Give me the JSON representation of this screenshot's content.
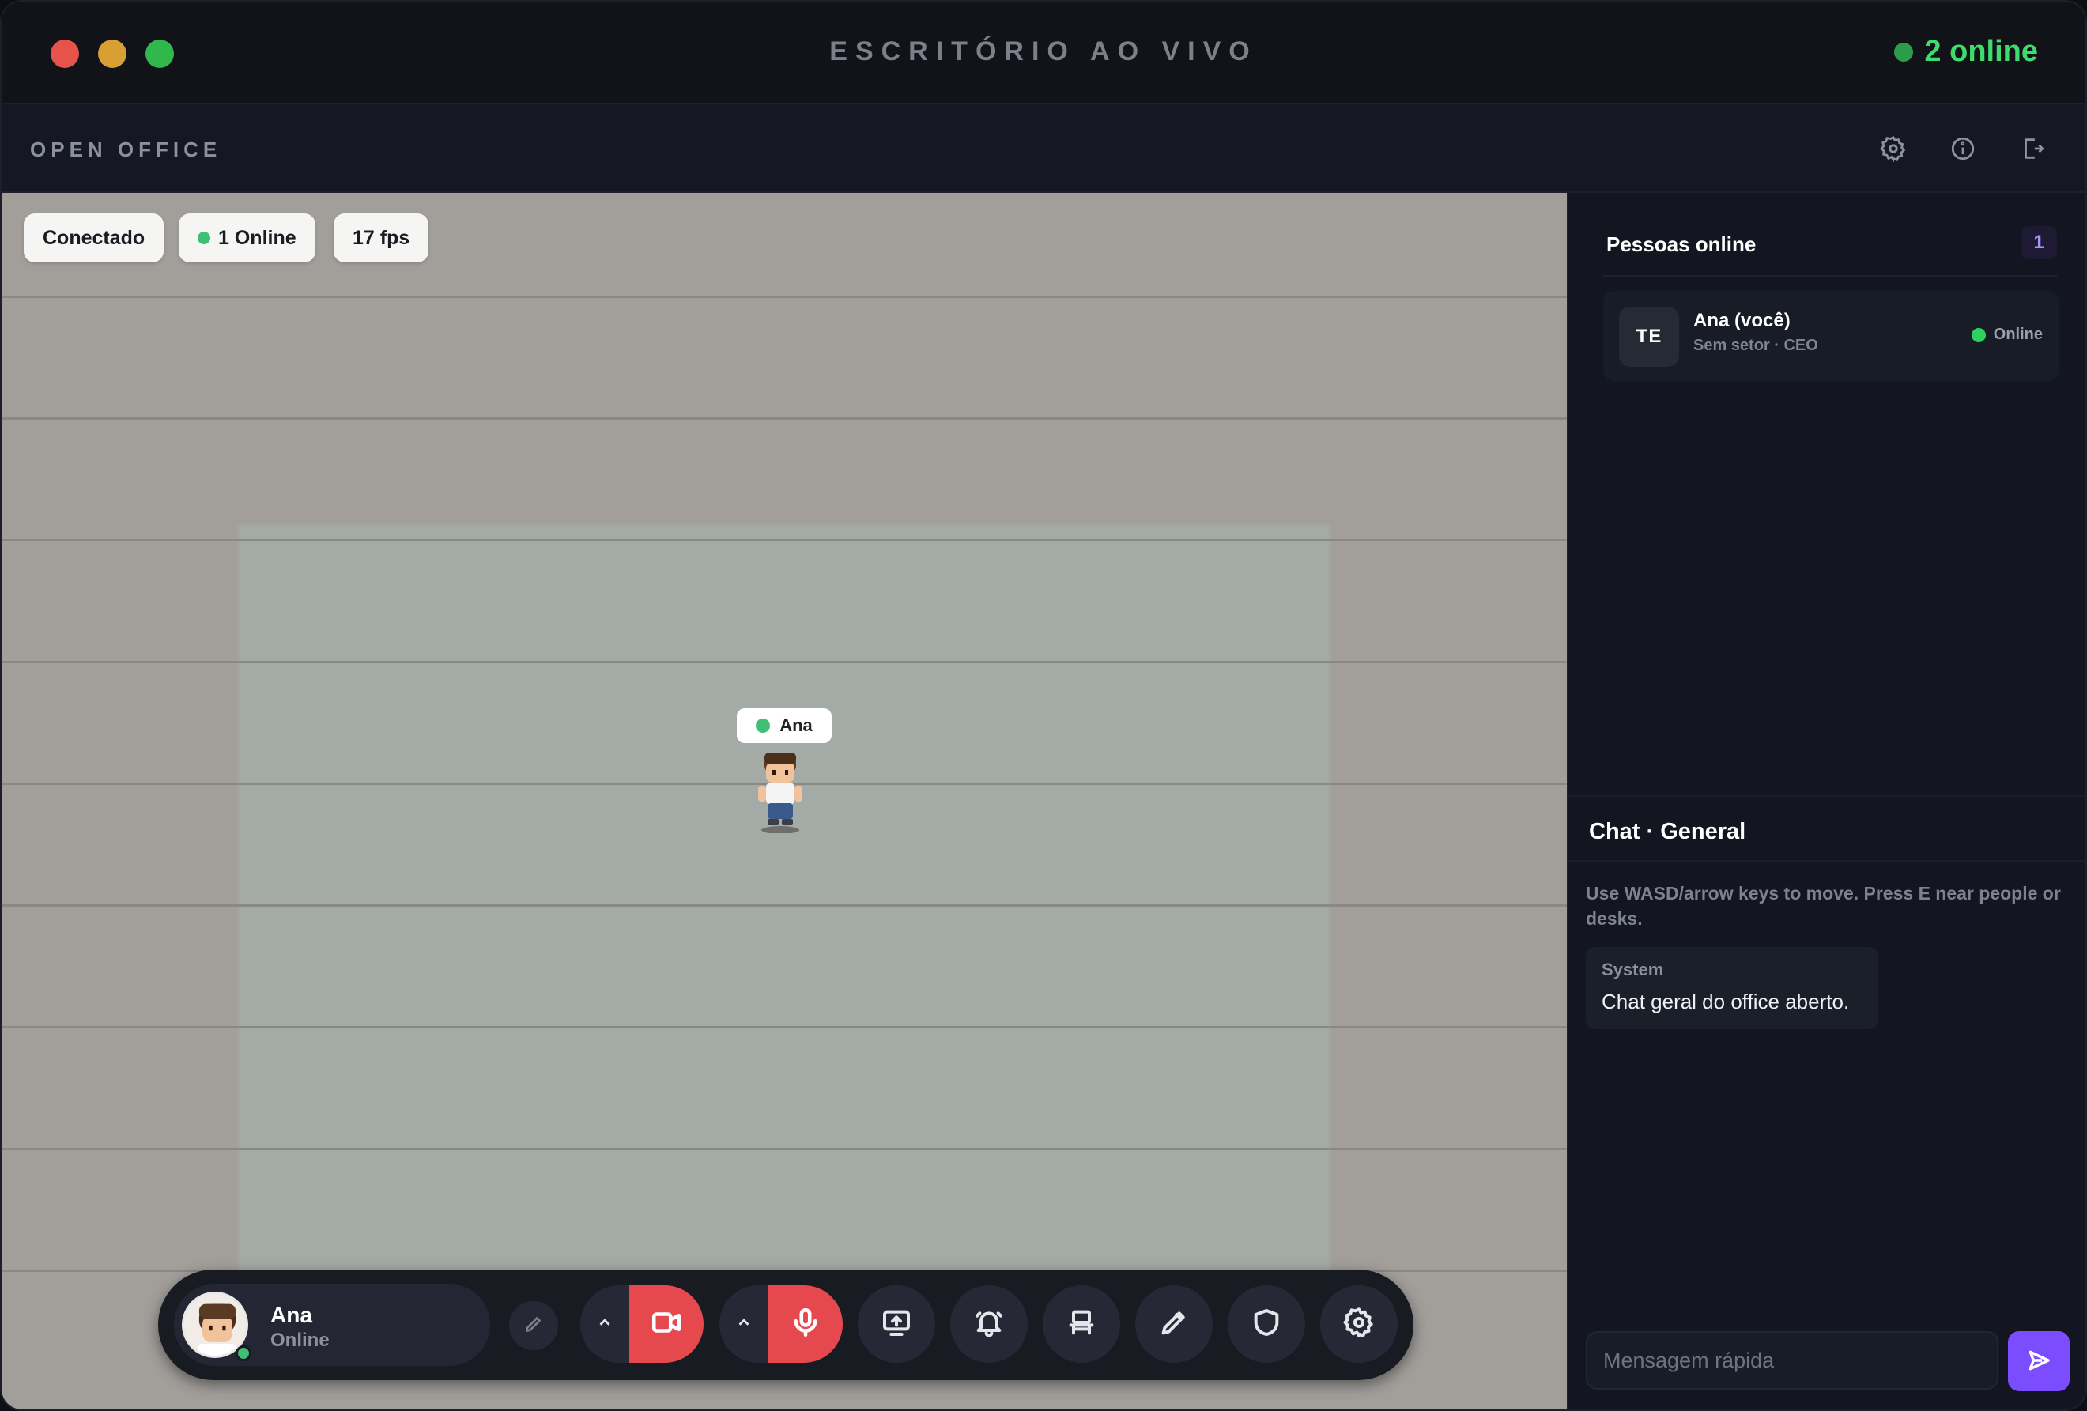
{
  "window": {
    "title": "ESCRITÓRIO AO VIVO",
    "online_count": "2 online"
  },
  "header": {
    "brand": "OPEN OFFICE",
    "icons": [
      "gear-icon",
      "info-icon",
      "logout-icon"
    ]
  },
  "map": {
    "pills": {
      "status": "Conectado",
      "online": "1 Online",
      "fps": "17 fps"
    },
    "avatar_label": "Ana"
  },
  "dock": {
    "user_name": "Ana",
    "user_status": "Online",
    "buttons": [
      "pencil-icon",
      "video-camera-icon",
      "microphone-icon",
      "screen-share-icon",
      "bell-icon",
      "desk-icon",
      "pen-icon",
      "shield-icon",
      "settings-icon"
    ]
  },
  "people": {
    "title": "Pessoas online",
    "count": "1",
    "list": [
      {
        "initials": "TE",
        "name": "Ana (você)",
        "subtitle": "Sem setor · CEO",
        "status": "Online"
      }
    ]
  },
  "chat": {
    "title": "Chat · General",
    "hint": "Use WASD/arrow keys to move. Press E near people or desks.",
    "messages": [
      {
        "author": "System",
        "text": "Chat geral do office aberto."
      }
    ],
    "input_placeholder": "Mensagem rápida"
  },
  "colors": {
    "accent": "#7b4dff",
    "online_green": "#3ddc6c",
    "danger_red": "#e5484d"
  }
}
